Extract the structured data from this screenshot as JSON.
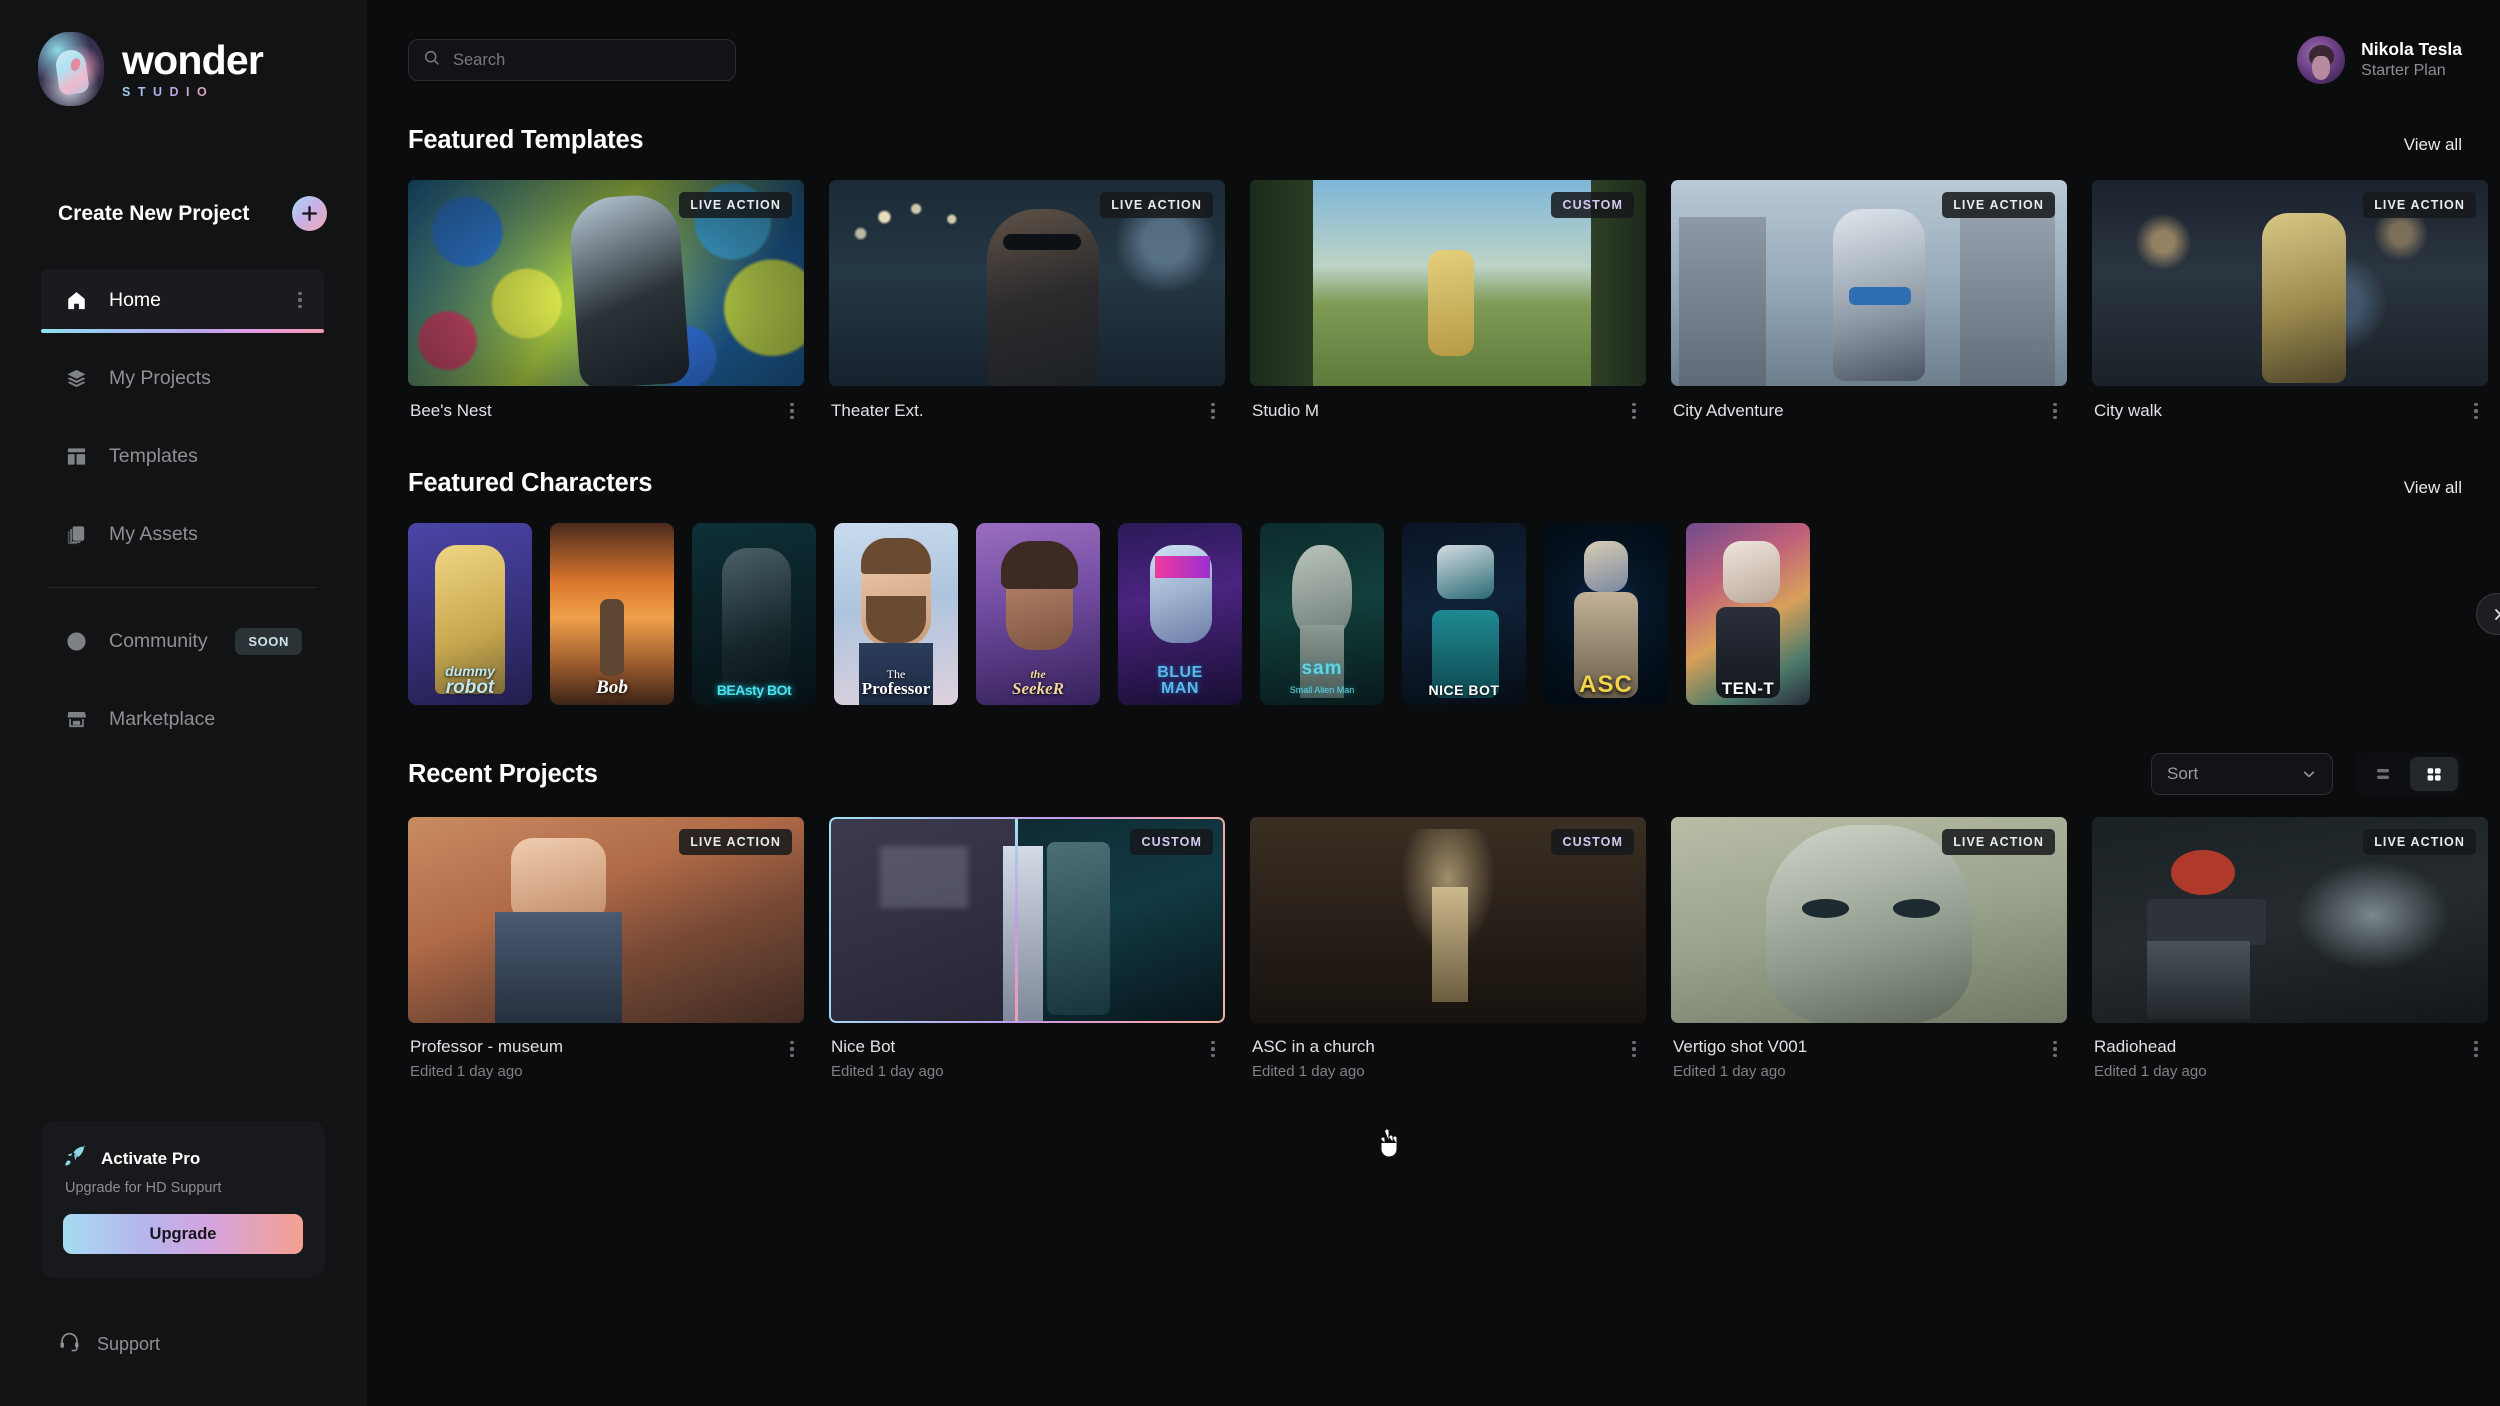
{
  "brand": {
    "name": "wonder",
    "sub": "STUDIO",
    "logo_icon": "wonder-avatar-logo"
  },
  "sidebar": {
    "create_label": "Create New Project",
    "create_icon": "plus-icon",
    "items": [
      {
        "label": "Home",
        "icon": "home-icon",
        "active": true
      },
      {
        "label": "My Projects",
        "icon": "layers-icon",
        "active": false
      },
      {
        "label": "Templates",
        "icon": "template-grid-icon",
        "active": false
      },
      {
        "label": "My Assets",
        "icon": "copy-stack-icon",
        "active": false
      }
    ],
    "items2": [
      {
        "label": "Community",
        "icon": "globe-icon",
        "badge": "SOON"
      },
      {
        "label": "Marketplace",
        "icon": "storefront-icon",
        "badge": ""
      }
    ],
    "promo": {
      "icon": "rocket-icon",
      "title": "Activate Pro",
      "subtitle": "Upgrade for HD Suppurt",
      "button": "Upgrade"
    },
    "support": {
      "label": "Support",
      "icon": "headset-icon"
    }
  },
  "topbar": {
    "search": {
      "placeholder": "Search",
      "value": "",
      "icon": "search-icon"
    },
    "user": {
      "name": "Nikola Tesla",
      "plan": "Starter Plan",
      "avatar_icon": "user-avatar"
    }
  },
  "featured_templates": {
    "title": "Featured Templates",
    "view_all": "View all",
    "cards": [
      {
        "name": "Bee's Nest",
        "badge": "LIVE ACTION",
        "menu_icon": "kebab-menu-icon"
      },
      {
        "name": "Theater Ext.",
        "badge": "LIVE ACTION",
        "menu_icon": "kebab-menu-icon"
      },
      {
        "name": "Studio M",
        "badge": "CUSTOM",
        "menu_icon": "kebab-menu-icon"
      },
      {
        "name": "City Adventure",
        "badge": "LIVE ACTION",
        "menu_icon": "kebab-menu-icon"
      },
      {
        "name": "City walk",
        "badge": "LIVE ACTION",
        "menu_icon": "kebab-menu-icon"
      }
    ]
  },
  "featured_characters": {
    "title": "Featured Characters",
    "view_all": "View all",
    "next_icon": "chevron-right-icon",
    "cards": [
      {
        "caption_top": "dummy",
        "caption": "robot"
      },
      {
        "caption_top": "",
        "caption": "Bob"
      },
      {
        "caption_top": "",
        "caption": "BEAsty BOt"
      },
      {
        "caption_top": "The",
        "caption": "Professor"
      },
      {
        "caption_top": "the",
        "caption": "SeekeR"
      },
      {
        "caption_top": "BLUE",
        "caption": "MAN"
      },
      {
        "caption_top": "sam",
        "caption": "Small Alien Man"
      },
      {
        "caption_top": "",
        "caption": "NICE BOT"
      },
      {
        "caption_top": "",
        "caption": "ASC"
      },
      {
        "caption_top": "",
        "caption": "TEN-T"
      }
    ]
  },
  "recent_projects": {
    "title": "Recent Projects",
    "sort": {
      "label": "Sort",
      "icon": "chevron-down-icon"
    },
    "view_list_icon": "list-view-icon",
    "view_grid_icon": "grid-view-icon",
    "active_view": "grid",
    "cards": [
      {
        "name": "Professor - museum",
        "subtitle": "Edited 1 day ago",
        "badge": "LIVE ACTION",
        "menu_icon": "kebab-menu-icon",
        "selected": false
      },
      {
        "name": "Nice Bot",
        "subtitle": "Edited 1 day ago",
        "badge": "CUSTOM",
        "menu_icon": "kebab-menu-icon",
        "selected": true
      },
      {
        "name": "ASC in a church",
        "subtitle": "Edited 1 day ago",
        "badge": "CUSTOM",
        "menu_icon": "kebab-menu-icon",
        "selected": false
      },
      {
        "name": "Vertigo shot V001",
        "subtitle": "Edited 1 day ago",
        "badge": "LIVE ACTION",
        "menu_icon": "kebab-menu-icon",
        "selected": false
      },
      {
        "name": "Radiohead",
        "subtitle": "Edited 1 day ago",
        "badge": "LIVE ACTION",
        "menu_icon": "kebab-menu-icon",
        "selected": false
      }
    ]
  },
  "colors": {
    "background": "#0b0c0e",
    "sidebar": "#121315",
    "accent_gradient_start": "#8fe0ef",
    "accent_gradient_mid": "#b9a6ec",
    "accent_gradient_end": "#f59ab0",
    "text_primary": "#ffffff",
    "text_muted": "#8d9094"
  }
}
